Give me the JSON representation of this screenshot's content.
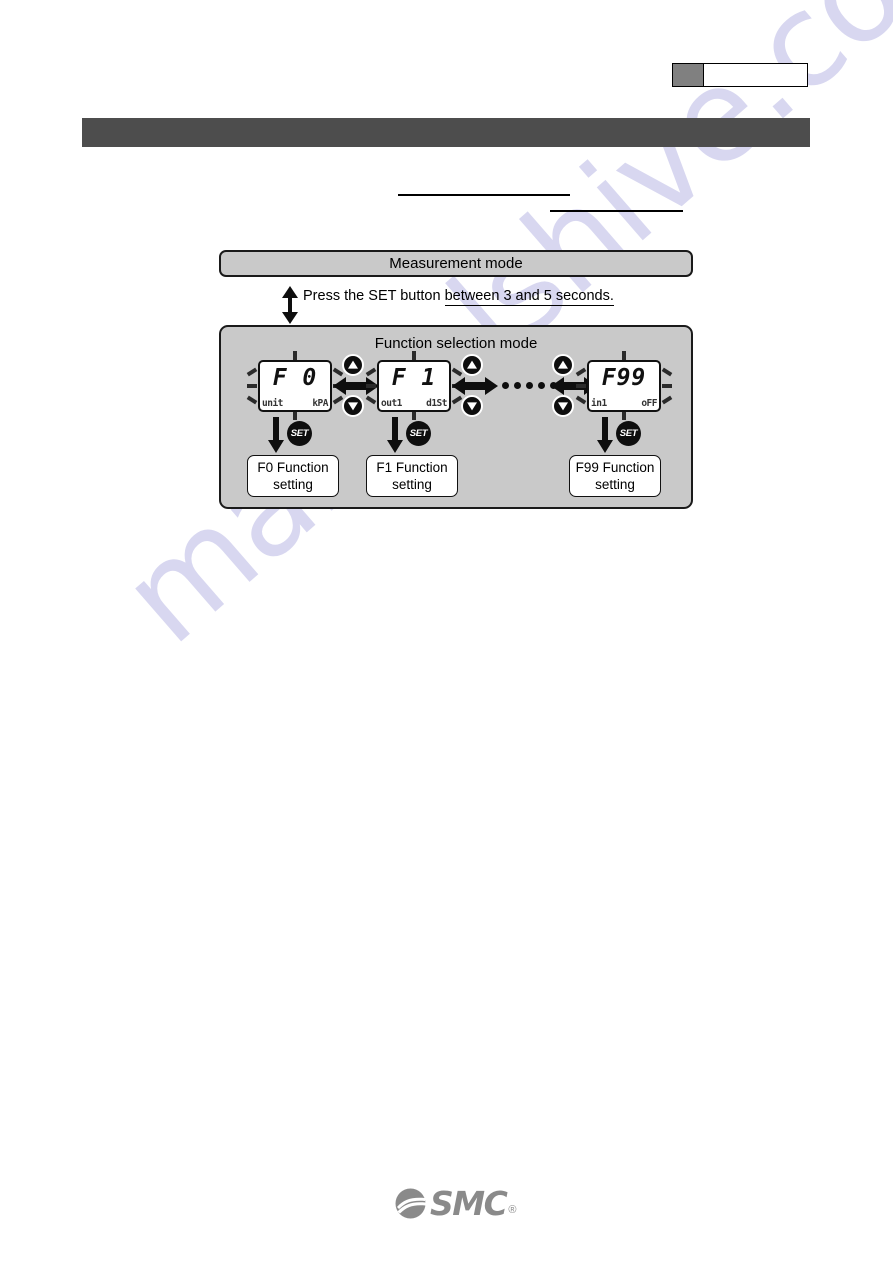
{
  "page": {
    "watermark": "manualshive.com",
    "header_box": {
      "name": "page-number-box",
      "gray_segment_color": "#808080"
    },
    "title_bar": {
      "color": "#4d4d4d",
      "text": ""
    },
    "rules": [
      "",
      ""
    ]
  },
  "diagram": {
    "measurement_mode": {
      "label": "Measurement mode"
    },
    "transition": {
      "text_before": "Press the SET button ",
      "text_underlined": "between 3 and 5 seconds."
    },
    "function_selection": {
      "title": "Function selection mode",
      "ellipsis_dots": 5,
      "screens": [
        {
          "id": "F0",
          "main": "F 0",
          "sub_left": "unit",
          "sub_right": "kPA",
          "up_label": "up-arrow",
          "down_label": "down-arrow",
          "set_label": "SET",
          "setting_line1": "F0 Function",
          "setting_line2": "setting"
        },
        {
          "id": "F1",
          "main": "F 1",
          "sub_left": "out1",
          "sub_right": "d1St",
          "up_label": "up-arrow",
          "down_label": "down-arrow",
          "set_label": "SET",
          "setting_line1": "F1 Function",
          "setting_line2": "setting"
        },
        {
          "id": "F99",
          "main": "F99",
          "sub_left": "in1",
          "sub_right": "oFF",
          "up_label": "up-arrow",
          "down_label": "down-arrow",
          "set_label": "SET",
          "setting_line1": "F99 Function",
          "setting_line2": "setting"
        }
      ]
    }
  },
  "footer": {
    "logo_text": "SMC",
    "logo_registered": "®",
    "logo_color": "#8a8a8a"
  }
}
